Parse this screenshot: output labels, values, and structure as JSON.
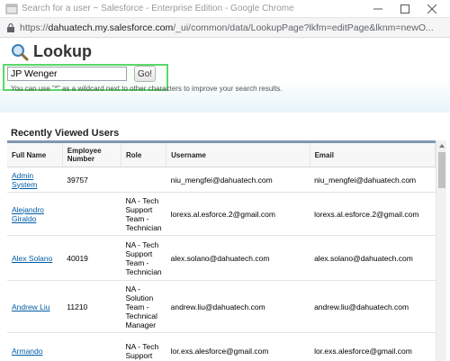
{
  "window": {
    "title": "Search for a user ~ Salesforce - Enterprise Edition - Google Chrome"
  },
  "address": {
    "protocol": "https://",
    "host": "dahuatech.my.salesforce.com",
    "path": "/_ui/common/data/LookupPage?lkfm=editPage&lknm=newO..."
  },
  "lookup": {
    "title": "Lookup",
    "search_value": "JP Wenger",
    "go_label": "Go!",
    "hint": "You can use \"*\" as a wildcard next to other characters to improve your search results."
  },
  "section_title": "Recently Viewed Users",
  "table": {
    "headers": [
      "Full Name",
      "Employee Number",
      "Role",
      "Username",
      "Email"
    ],
    "rows": [
      {
        "name": "Admin System",
        "employee": "39757",
        "role": "",
        "username": "niu_mengfei@dahuatech.com",
        "email": "niu_mengfei@dahuatech.com"
      },
      {
        "name": "Alejandro Giraldo",
        "employee": "",
        "role": "NA - Tech Support Team - Technician",
        "username": "lorexs.al.esforce.2@gmail.com",
        "email": "lorexs.al.esforce.2@gmail.com"
      },
      {
        "name": "Alex Solano",
        "employee": "40019",
        "role": "NA - Tech Support Team - Technician",
        "username": "alex.solano@dahuatech.com",
        "email": "alex.solano@dahuatech.com"
      },
      {
        "name": "Andrew Liu",
        "employee": "11210",
        "role": "NA - Solution Team - Technical Manager",
        "username": "andrew.liu@dahuatech.com",
        "email": "andrew.liu@dahuatech.com"
      },
      {
        "name": "Armando",
        "employee": "",
        "role": "NA - Tech Support",
        "username": "lor.exs.alesforce@gmail.com",
        "email": "lor.exs.alesforce@gmail.com"
      }
    ]
  }
}
